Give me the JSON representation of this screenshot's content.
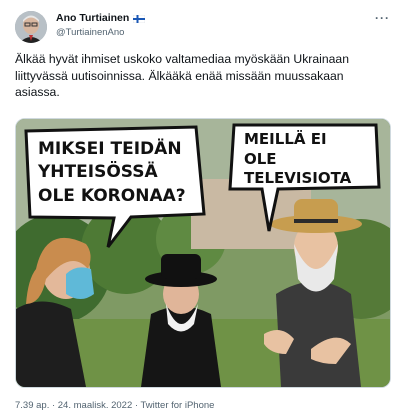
{
  "author": {
    "name": "Ano Turtiainen",
    "handle": "@TurtiainenAno",
    "flag_icon": "finland-flag-icon"
  },
  "tweet": {
    "text": "Älkää hyvät ihmiset uskoko valtamediaa myöskään Ukrainaan liittyvässä uutisoinnissa. Älkääkä enää missään muussakaan asiassa.",
    "timestamp": "7.39 ap. · 24. maalisk. 2022 · Twitter for iPhone"
  },
  "image": {
    "bubble_left": [
      "MIKSEI TEIDÄN",
      "YHTEISÖSSÄ",
      "OLE KORONAA?"
    ],
    "bubble_right": [
      "MEILLÄ EI",
      "OLE",
      "TELEVISIOTA"
    ]
  },
  "colors": {
    "text": "#0f1419",
    "muted": "#536471",
    "border": "#cfd9de"
  }
}
